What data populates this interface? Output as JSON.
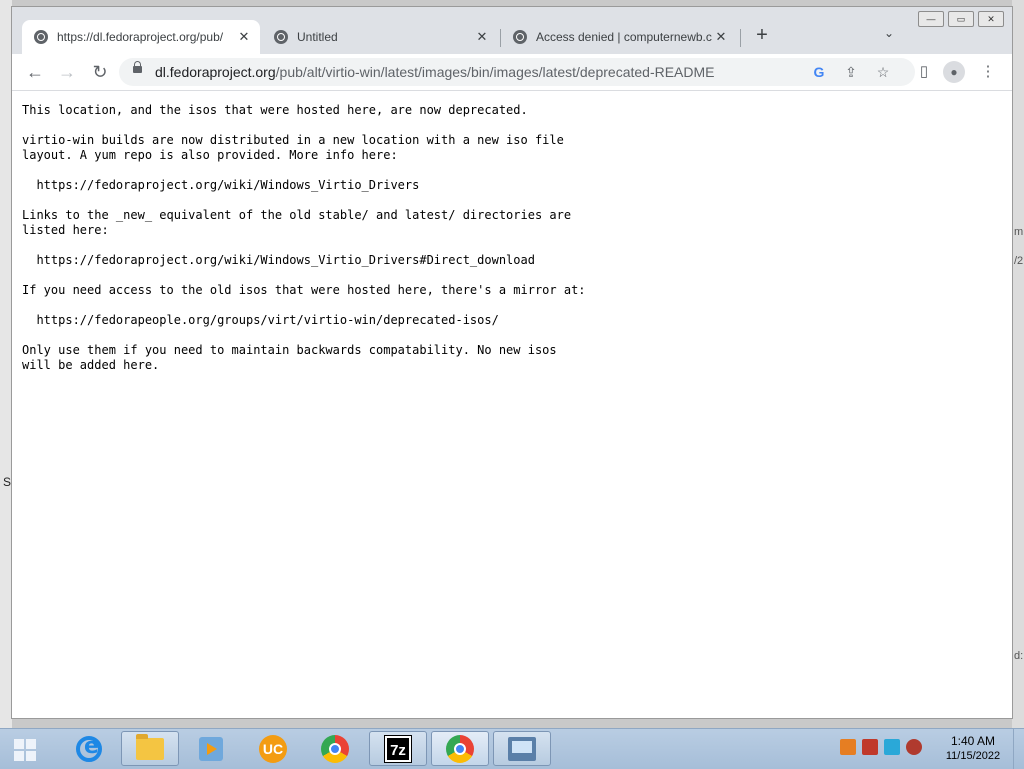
{
  "desktop": {
    "left_fragment": "S",
    "right_fragments": [
      "m",
      "/2",
      "d:"
    ]
  },
  "window_controls": {
    "minimize": "—",
    "maximize": "▭",
    "close": "✕"
  },
  "tabs": [
    {
      "title": "https://dl.fedoraproject.org/pub/",
      "active": true,
      "close": "✕"
    },
    {
      "title": "Untitled",
      "active": false,
      "close": "✕"
    },
    {
      "title": "Access denied | computernewb.c",
      "active": false,
      "close": "✕"
    }
  ],
  "new_tab_label": "+",
  "tab_search_label": "⌄",
  "toolbar": {
    "back": "←",
    "forward": "→",
    "reload": "↻",
    "url_host": "dl.fedoraproject.org",
    "url_path": "/pub/alt/virtio-win/latest/images/bin/images/latest/deprecated-README",
    "google_icon": "G",
    "share_icon": "⇪",
    "bookmark_icon": "☆",
    "sidepanel_icon": "▯",
    "profile_icon": "●",
    "menu_icon": "⋮"
  },
  "page": {
    "text": "This location, and the isos that were hosted here, are now deprecated.\n\nvirtio-win builds are now distributed in a new location with a new iso file\nlayout. A yum repo is also provided. More info here:\n\n  https://fedoraproject.org/wiki/Windows_Virtio_Drivers\n\nLinks to the _new_ equivalent of the old stable/ and latest/ directories are\nlisted here:\n\n  https://fedoraproject.org/wiki/Windows_Virtio_Drivers#Direct_download\n\nIf you need access to the old isos that were hosted here, there's a mirror at:\n\n  https://fedorapeople.org/groups/virt/virtio-win/deprecated-isos/\n\nOnly use them if you need to maintain backwards compatability. No new isos\nwill be added here."
  },
  "taskbar": {
    "apps": [
      {
        "name": "internet-explorer-icon"
      },
      {
        "name": "file-explorer-icon"
      },
      {
        "name": "media-player-icon"
      },
      {
        "name": "uc-browser-icon",
        "glyph": "UC"
      },
      {
        "name": "chrome-icon"
      },
      {
        "name": "7zip-icon",
        "glyph": "7z"
      },
      {
        "name": "chrome-icon"
      },
      {
        "name": "network-icon"
      }
    ],
    "time": "1:40 AM",
    "date": "11/15/2022"
  }
}
